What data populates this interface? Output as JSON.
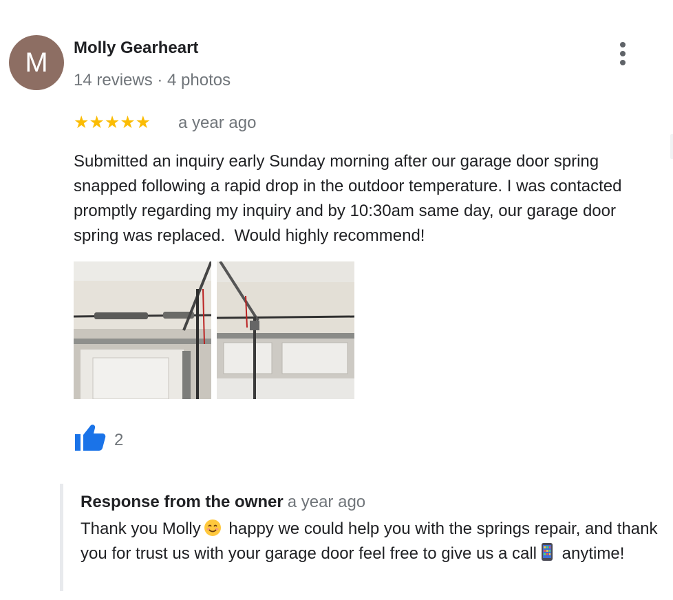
{
  "reviewer": {
    "initial": "M",
    "name": "Molly Gearheart",
    "stats": "14 reviews · 4 photos",
    "avatar_color": "#8d6e63"
  },
  "review": {
    "rating": 5,
    "stars": "★★★★★",
    "age": "a year ago",
    "text": "Submitted an inquiry early Sunday morning after our garage door spring snapped following a rapid drop in the outdoor temperature. I was contacted promptly regarding my inquiry and by 10:30am same day, our garage door spring was replaced.  Would highly recommend!",
    "likes": "2"
  },
  "owner_response": {
    "title": "Response from the owner",
    "age": "a year ago",
    "text_part1": "Thank you Molly",
    "text_part2": " happy we could help you with the springs repair, and thank you for trust us with your garage door feel free to give us a call",
    "text_part3": " anytime!",
    "emoji1": "smiling-face-emoji",
    "emoji2": "mobile-phone-emoji"
  },
  "icons": {
    "menu": "more-vert-icon",
    "like": "thumbs-up-icon",
    "star": "star-icon"
  },
  "colors": {
    "star": "#fbbc04",
    "like": "#1a73e8",
    "muted": "#70757a",
    "text": "#202124"
  }
}
